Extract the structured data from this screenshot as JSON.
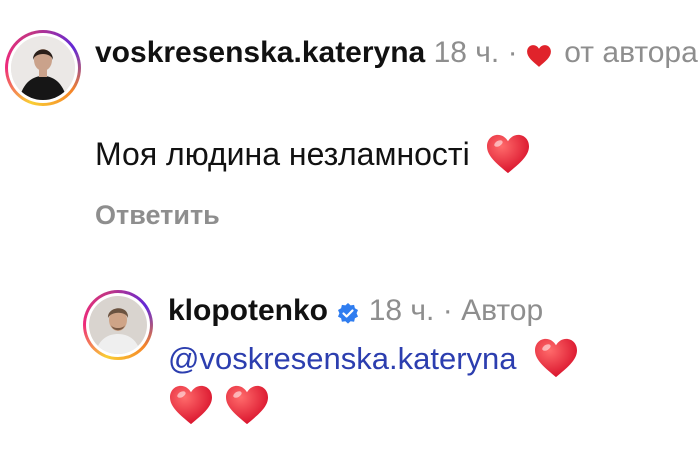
{
  "comment": {
    "username": "voskresenska.kateryna",
    "time": "18 ч.",
    "separator": "·",
    "liked_by_author_label": "от автора",
    "text": "Моя людина незламності",
    "reply_label": "Ответить",
    "heart_color": "#e0232b"
  },
  "reply": {
    "username": "klopotenko",
    "verified_icon": "verified-badge-icon",
    "time": "18 ч.",
    "separator": "·",
    "author_label": "Автор",
    "mention": "@voskresenska.kateryna",
    "heart_color": "#e0232b"
  },
  "colors": {
    "username": "#111111",
    "meta": "#8e8e8e",
    "mention": "#2c3eaf",
    "verified": "#2f7df0"
  }
}
